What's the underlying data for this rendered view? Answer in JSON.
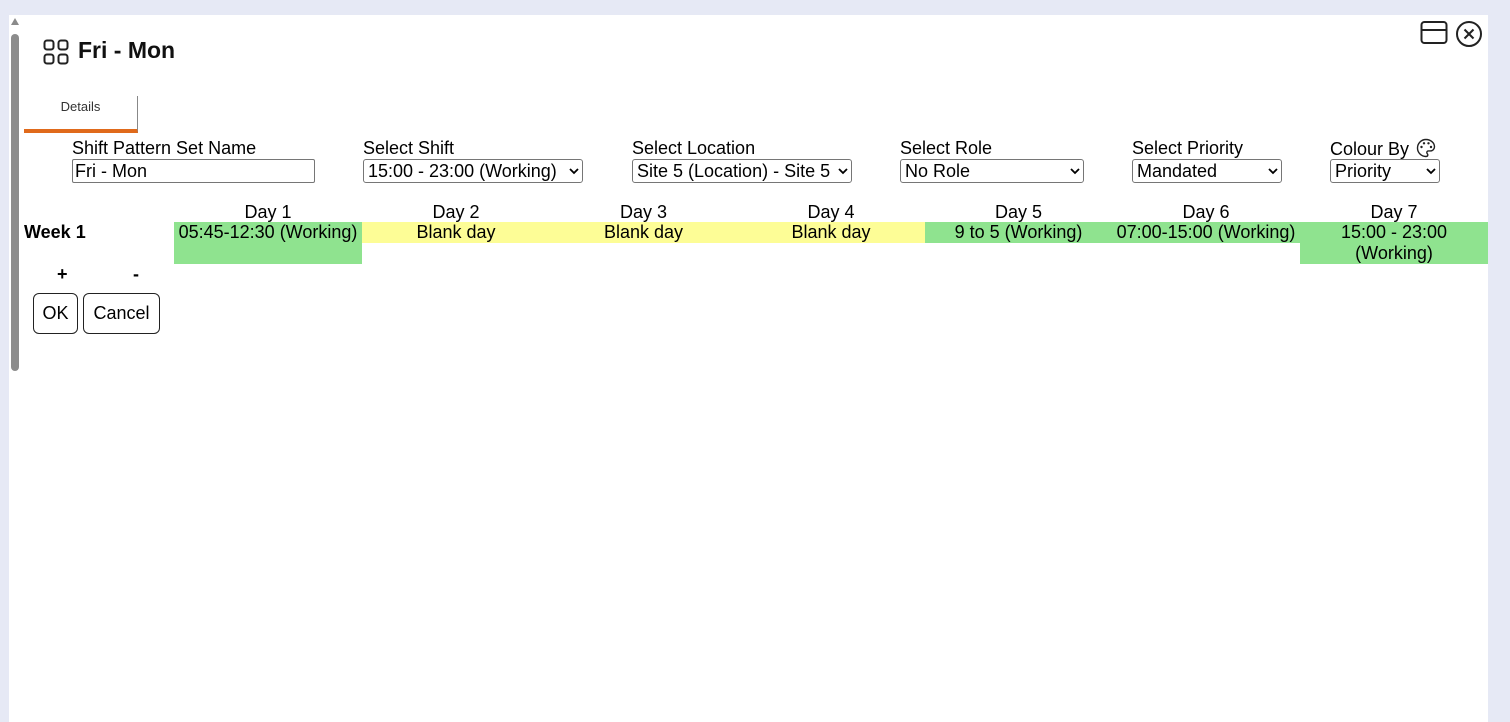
{
  "window": {
    "title": "Fri - Mon",
    "icons": [
      "grid-icon",
      "restore-window-icon",
      "close-circle-icon"
    ]
  },
  "tabs": [
    {
      "label": "Details",
      "active": true
    }
  ],
  "form": {
    "name_label": "Shift Pattern Set Name",
    "name_value": "Fri - Mon",
    "shift_label": "Select Shift",
    "shift_value": "15:00 - 23:00 (Working)",
    "location_label": "Select Location",
    "location_value": "Site 5 (Location) - Site 5",
    "role_label": "Select Role",
    "role_value": "No Role",
    "priority_label": "Select Priority",
    "priority_value": "Mandated",
    "colour_label": "Colour By",
    "colour_value": "Priority"
  },
  "schedule": {
    "days": [
      "Day 1",
      "Day 2",
      "Day 3",
      "Day 4",
      "Day 5",
      "Day 6",
      "Day 7"
    ],
    "week_label": "Week 1",
    "cells": [
      {
        "text": "05:45-12:30 (Working)",
        "color": "#8fe38f"
      },
      {
        "text": "Blank day",
        "color": "#fdfd96"
      },
      {
        "text": "Blank day",
        "color": "#fdfd96"
      },
      {
        "text": "Blank day",
        "color": "#fdfd96"
      },
      {
        "text": "9 to 5 (Working)",
        "color": "#8fe38f"
      },
      {
        "text": "07:00-15:00 (Working)",
        "color": "#8fe38f"
      },
      {
        "text": "15:00 - 23:00 (Working)",
        "color": "#8fe38f"
      }
    ],
    "add_label": "+",
    "remove_label": "-"
  },
  "buttons": {
    "ok": "OK",
    "cancel": "Cancel"
  },
  "colors": {
    "accent": "#e06a1b",
    "working": "#8fe38f",
    "blank": "#fdfd96"
  }
}
